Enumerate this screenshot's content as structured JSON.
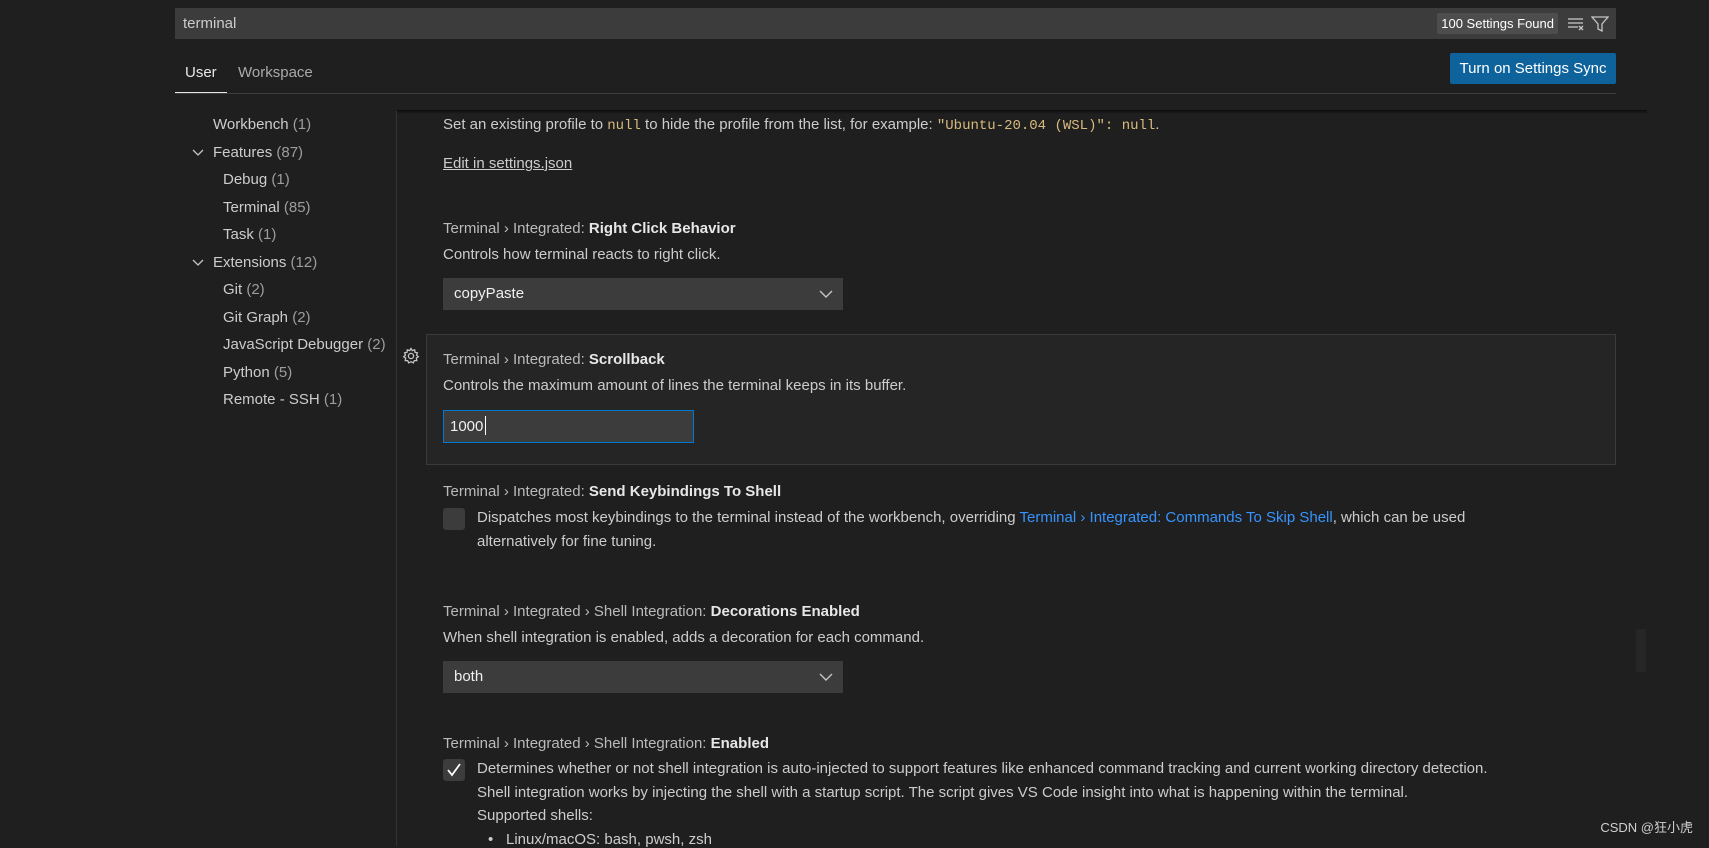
{
  "search": {
    "value": "terminal",
    "results_count": "100 Settings Found",
    "clear_icon": "clear-filter-icon",
    "filter_icon": "filter-icon"
  },
  "tabs": [
    {
      "label": "User",
      "active": true
    },
    {
      "label": "Workspace",
      "active": false
    }
  ],
  "sync_button": "Turn on Settings Sync",
  "sidebar": {
    "items": [
      {
        "label": "Workbench",
        "count": "(1)",
        "level": 1,
        "expanded": null
      },
      {
        "label": "Features",
        "count": "(87)",
        "level": 1,
        "expanded": true
      },
      {
        "label": "Debug",
        "count": "(1)",
        "level": 2
      },
      {
        "label": "Terminal",
        "count": "(85)",
        "level": 2
      },
      {
        "label": "Task",
        "count": "(1)",
        "level": 2
      },
      {
        "label": "Extensions",
        "count": "(12)",
        "level": 1,
        "expanded": true
      },
      {
        "label": "Git",
        "count": "(2)",
        "level": 2
      },
      {
        "label": "Git Graph",
        "count": "(2)",
        "level": 2
      },
      {
        "label": "JavaScript Debugger",
        "count": "(2)",
        "level": 2
      },
      {
        "label": "Python",
        "count": "(5)",
        "level": 2
      },
      {
        "label": "Remote - SSH",
        "count": "(1)",
        "level": 2
      }
    ]
  },
  "content": {
    "profiles_tail": {
      "text_before": "Set an existing profile to ",
      "code1": "null",
      "text_middle": " to hide the profile from the list, for example: ",
      "code2": "\"Ubuntu-20.04 (WSL)\": null",
      "text_after": ".",
      "edit_link": "Edit in settings.json"
    },
    "right_click": {
      "category": "Terminal › Integrated: ",
      "name": "Right Click Behavior",
      "description": "Controls how terminal reacts to right click.",
      "value": "copyPaste"
    },
    "scrollback": {
      "category": "Terminal › Integrated: ",
      "name": "Scrollback",
      "description": "Controls the maximum amount of lines the terminal keeps in its buffer.",
      "value": "1000"
    },
    "send_keybindings": {
      "category": "Terminal › Integrated: ",
      "name": "Send Keybindings To Shell",
      "description_before": "Dispatches most keybindings to the terminal instead of the workbench, overriding ",
      "link": "Terminal › Integrated: Commands To Skip Shell",
      "description_after": ", which can be used",
      "description_line2": "alternatively for fine tuning.",
      "checked": false
    },
    "decorations": {
      "category": "Terminal › Integrated › Shell Integration: ",
      "name": "Decorations Enabled",
      "description": "When shell integration is enabled, adds a decoration for each command.",
      "value": "both"
    },
    "shell_integration": {
      "category": "Terminal › Integrated › Shell Integration: ",
      "name": "Enabled",
      "line1": "Determines whether or not shell integration is auto-injected to support features like enhanced command tracking and current working directory detection.",
      "line2": "Shell integration works by injecting the shell with a startup script. The script gives VS Code insight into what is happening within the terminal.",
      "line3": "Supported shells:",
      "bullet1": "Linux/macOS: bash, pwsh, zsh",
      "checked": true
    }
  },
  "watermark": "CSDN @狂小虎",
  "colors": {
    "accent": "#0e639c",
    "focus": "#0078d4",
    "link": "#3794ff",
    "code": "#d7ba7d"
  }
}
